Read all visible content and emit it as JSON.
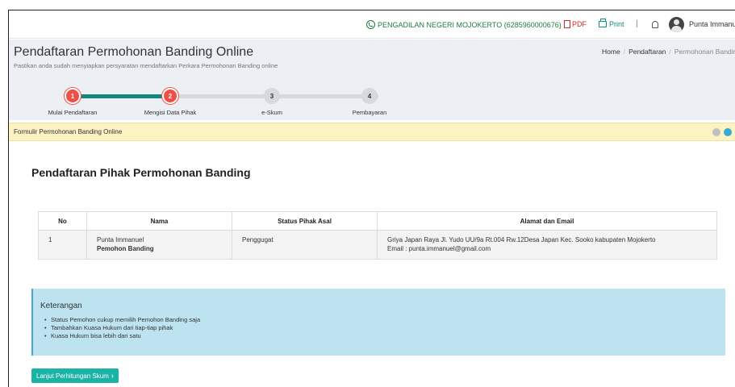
{
  "topbar": {
    "court_contact": "PENGADILAN NEGERI MOJOKERTO (6285960000676)",
    "pdf_label": "PDF",
    "print_label": "Print",
    "separator": "|",
    "user_name": "Punta Immanuel"
  },
  "header": {
    "title": "Pendaftaran Permohonan Banding Online",
    "subtitle": "Pastikan anda sudah menyiapkan persyaratan mendaftarkan Perkara Permohonan Banding online",
    "breadcrumb": [
      "Home",
      "Pendaftaran",
      "Permohonan Banding"
    ]
  },
  "steps": [
    {
      "number": "1",
      "label": "Mulai Pendaftaran",
      "status": "done"
    },
    {
      "number": "2",
      "label": "Mengisi Data Pihak",
      "status": "done"
    },
    {
      "number": "3",
      "label": "e-Skum",
      "status": "todo"
    },
    {
      "number": "4",
      "label": "Pembayaran",
      "status": "todo"
    }
  ],
  "panel": {
    "title": "Formulir Permohonan Banding Online"
  },
  "section_title": "Pendaftaran Pihak Permohonan Banding",
  "table": {
    "headers": [
      "No",
      "Nama",
      "Status Pihak Asal",
      "Alamat dan Email"
    ],
    "rows": [
      {
        "no": "1",
        "name": "Punta Immanuel",
        "role": "Pemohon Banding",
        "status": "Penggugat",
        "address": "Griya Japan Raya Jl. Yudo UU/9a Rt.004 Rw.12Desa Japan Kec. Sooko kabupaten Mojokerto",
        "email": "Email : punta.immanuel@gmail.com"
      }
    ]
  },
  "note": {
    "title": "Keterangan",
    "items": [
      "Status Pemohon cukup memilih Pemohon Banding saja",
      "Tambahkan Kuasa Hukum dari tiap-tiap pihak",
      "Kuasa Hukum bisa lebih dari satu"
    ]
  },
  "next_button": "Lanjut Perhitungan Skum",
  "colors": {
    "step_done": "#ef4f45",
    "step_line_done": "#13877b",
    "step_todo": "#d6dadf",
    "panel_bg": "#fbf3c1",
    "note_bg": "#bde3f0",
    "button_bg": "#1bb3a5",
    "whatsapp": "#1f7a3f",
    "pdf": "#d9281e",
    "print": "#0f8a7e"
  }
}
